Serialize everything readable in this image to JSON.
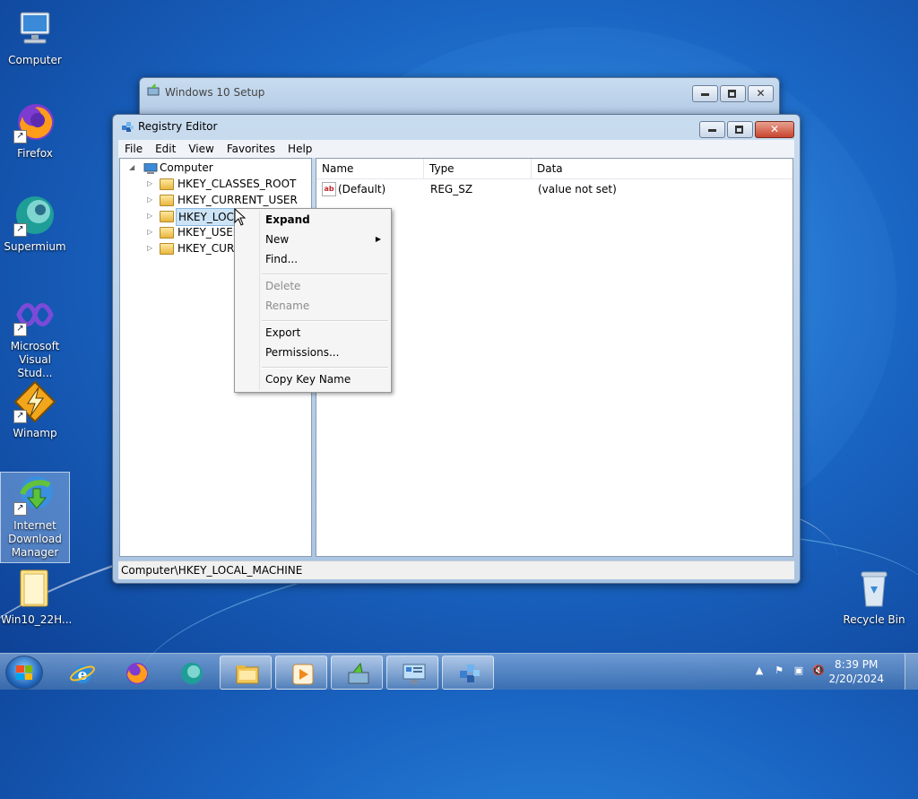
{
  "desktop": {
    "icons": [
      {
        "label": "Computer"
      },
      {
        "label": "Firefox"
      },
      {
        "label": "Supermium"
      },
      {
        "label": "Microsoft Visual Stud..."
      },
      {
        "label": "Winamp"
      },
      {
        "label": "Internet Download Manager"
      },
      {
        "label": "Win10_22H..."
      },
      {
        "label": "Recycle Bin"
      }
    ]
  },
  "setup_window": {
    "title": "Windows 10 Setup"
  },
  "regedit": {
    "title": "Registry Editor",
    "menu": [
      "File",
      "Edit",
      "View",
      "Favorites",
      "Help"
    ],
    "tree": {
      "root": "Computer",
      "items": [
        "HKEY_CLASSES_ROOT",
        "HKEY_CURRENT_USER",
        "HKEY_LOCA",
        "HKEY_USERS",
        "HKEY_CURR"
      ]
    },
    "columns": [
      "Name",
      "Type",
      "Data"
    ],
    "values": [
      {
        "name": "(Default)",
        "type": "REG_SZ",
        "data": "(value not set)",
        "icon": "ab"
      }
    ],
    "status": "Computer\\HKEY_LOCAL_MACHINE"
  },
  "context_menu": {
    "items": [
      {
        "label": "Expand",
        "bold": true
      },
      {
        "label": "New",
        "submenu": true
      },
      {
        "label": "Find..."
      },
      {
        "label": "Delete",
        "disabled": true
      },
      {
        "label": "Rename",
        "disabled": true
      },
      {
        "label": "Export"
      },
      {
        "label": "Permissions..."
      },
      {
        "label": "Copy Key Name"
      }
    ]
  },
  "taskbar": {
    "time": "8:39 PM",
    "date": "2/20/2024"
  }
}
